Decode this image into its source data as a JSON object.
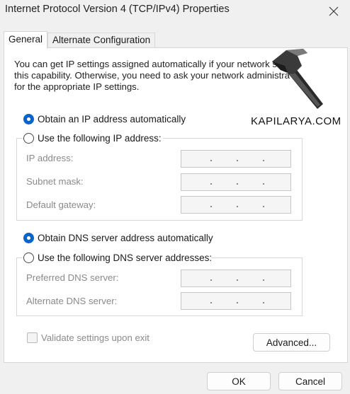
{
  "window": {
    "title": "Internet Protocol Version 4 (TCP/IPv4) Properties"
  },
  "tabs": [
    {
      "label": "General",
      "active": true
    },
    {
      "label": "Alternate Configuration",
      "active": false
    }
  ],
  "description_lines": [
    "You can get IP settings assigned automatically if your network suppo",
    "this capability. Otherwise, you need to ask your network administra",
    "for the appropriate IP settings."
  ],
  "ip": {
    "auto_label": "Obtain an IP address automatically",
    "manual_label": "Use the following IP address:",
    "selected": "auto",
    "fields": [
      {
        "label": "IP address:"
      },
      {
        "label": "Subnet mask:"
      },
      {
        "label": "Default gateway:"
      }
    ]
  },
  "dns": {
    "auto_label": "Obtain DNS server address automatically",
    "manual_label": "Use the following DNS server addresses:",
    "selected": "auto",
    "fields": [
      {
        "label": "Preferred DNS server:"
      },
      {
        "label": "Alternate DNS server:"
      }
    ]
  },
  "validate": {
    "label": "Validate settings upon exit",
    "checked": false,
    "enabled": false
  },
  "buttons": {
    "advanced": "Advanced...",
    "ok": "OK",
    "cancel": "Cancel"
  },
  "watermark": {
    "text": "KAPILARYA.COM"
  },
  "colors": {
    "accent": "#0a63c9",
    "disabled_text": "#8a8a8a",
    "window_bg": "#f0f0f0"
  }
}
